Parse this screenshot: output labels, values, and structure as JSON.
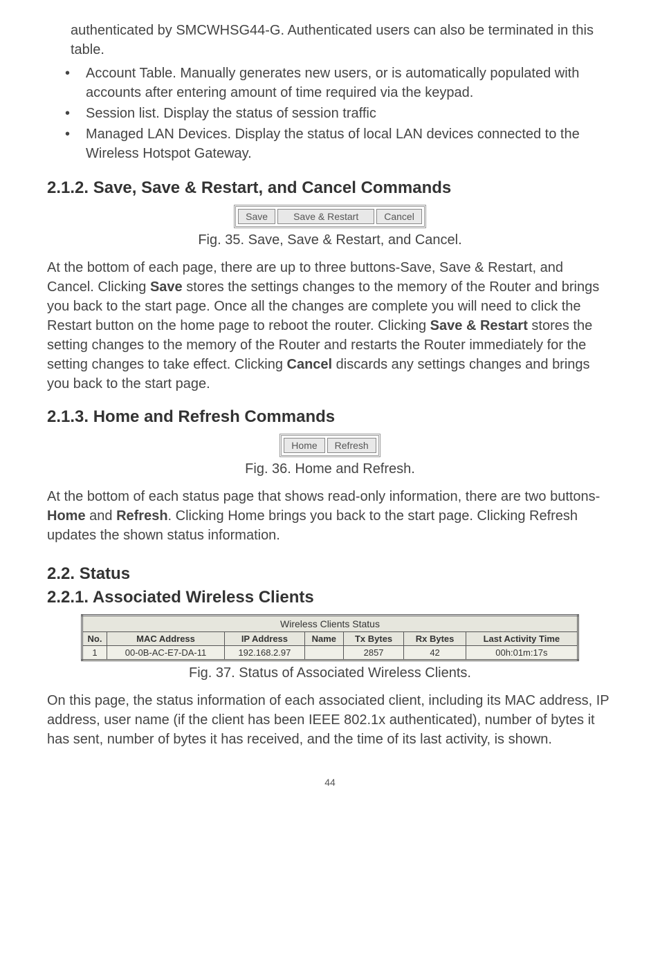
{
  "intro_continuation": "authenticated by SMCWHSG44-G. Authenticated users can also be terminated in this table.",
  "bullets": [
    "Account Table. Manually generates new users, or is automatically populated with accounts after entering amount of time required via the keypad.",
    "Session list. Display the status of session traffic",
    "Managed LAN Devices. Display the status of local LAN devices connected to the Wireless Hotspot Gateway."
  ],
  "section_212": {
    "heading": "2.1.2. Save, Save & Restart, and Cancel Commands",
    "buttons": {
      "save": "Save",
      "save_restart": "Save & Restart",
      "cancel": "Cancel"
    },
    "caption": "Fig. 35. Save, Save & Restart, and Cancel.",
    "para_pre": "At the bottom of each page, there are up to three buttons-Save, Save & Restart, and Cancel. Clicking ",
    "save_b": "Save",
    "para_mid1": " stores the settings changes to the memory of the Router and brings you back to the start page. Once all the changes are complete you will need to click the Restart button on the home page to reboot the router. Clicking ",
    "saverestart_b": "Save & Restart",
    "para_mid2": " stores the setting changes to the memory of the Router and restarts the Router immediately for the setting changes to take effect. Clicking ",
    "cancel_b": "Cancel",
    "para_end": " discards any settings changes and brings you back to the start page."
  },
  "section_213": {
    "heading": "2.1.3. Home and Refresh Commands",
    "buttons": {
      "home": "Home",
      "refresh": "Refresh"
    },
    "caption": "Fig. 36. Home and Refresh.",
    "para_pre": "At the bottom of each status page that shows read-only information, there are two buttons-",
    "home_b": "Home",
    "para_mid1": " and ",
    "refresh_b": "Refresh",
    "para_end": ". Clicking Home brings you back to the start page. Clicking Refresh updates the shown status information."
  },
  "section_22": {
    "heading": "2.2. Status"
  },
  "section_221": {
    "heading": "2.2.1. Associated Wireless Clients",
    "table": {
      "title": "Wireless Clients Status",
      "headers": [
        "No.",
        "MAC Address",
        "IP Address",
        "Name",
        "Tx Bytes",
        "Rx Bytes",
        "Last Activity Time"
      ],
      "row": [
        "1",
        "00-0B-AC-E7-DA-11",
        "192.168.2.97",
        "",
        "2857",
        "42",
        "00h:01m:17s"
      ]
    },
    "caption": "Fig. 37. Status of Associated Wireless Clients.",
    "para": "On this page, the status information of each associated client, including its MAC address, IP address, user name (if the client has been IEEE 802.1x authenticated), number of bytes it has sent, number of bytes it has received, and the time of its last activity, is shown."
  },
  "page_number": "44"
}
